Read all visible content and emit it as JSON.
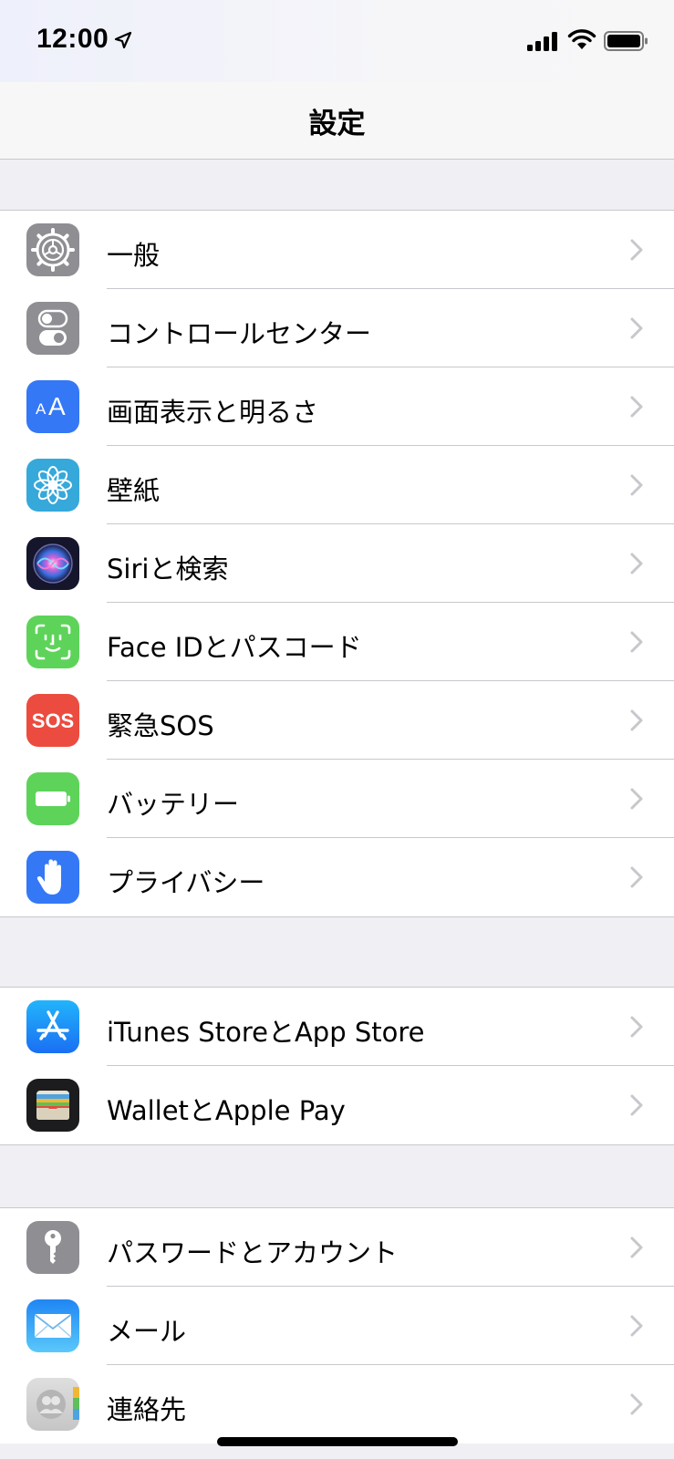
{
  "status_bar": {
    "time": "12:00"
  },
  "nav": {
    "title": "設定"
  },
  "groups": [
    {
      "items": [
        {
          "label": "一般",
          "icon": "gear-icon",
          "color": "#8e8e93"
        },
        {
          "label": "コントロールセンター",
          "icon": "toggles-icon",
          "color": "#8e8e93"
        },
        {
          "label": "画面表示と明るさ",
          "icon": "text-size-icon",
          "color": "#3478f6"
        },
        {
          "label": "壁紙",
          "icon": "flower-icon",
          "color": "#36a8da"
        },
        {
          "label": "Siriと検索",
          "icon": "siri-icon",
          "color": "#1b1b3a"
        },
        {
          "label": "Face IDとパスコード",
          "icon": "face-id-icon",
          "color": "#5ed35a"
        },
        {
          "label": "緊急SOS",
          "icon": "sos-icon",
          "color": "#eb4c3f"
        },
        {
          "label": "バッテリー",
          "icon": "battery-icon",
          "color": "#5ed35a"
        },
        {
          "label": "プライバシー",
          "icon": "hand-icon",
          "color": "#3478f6"
        }
      ]
    },
    {
      "items": [
        {
          "label": "iTunes StoreとApp Store",
          "icon": "app-store-icon",
          "color": "#1c8ef9"
        },
        {
          "label": "WalletとApple Pay",
          "icon": "wallet-icon",
          "color": "#1c1c1e"
        }
      ]
    },
    {
      "items": [
        {
          "label": "パスワードとアカウント",
          "icon": "key-icon",
          "color": "#8e8e93"
        },
        {
          "label": "メール",
          "icon": "mail-icon",
          "color": "#3d9bf7"
        },
        {
          "label": "連絡先",
          "icon": "contacts-icon",
          "color": "#cfcfcf"
        }
      ]
    }
  ],
  "sos_icon_text": "SOS"
}
